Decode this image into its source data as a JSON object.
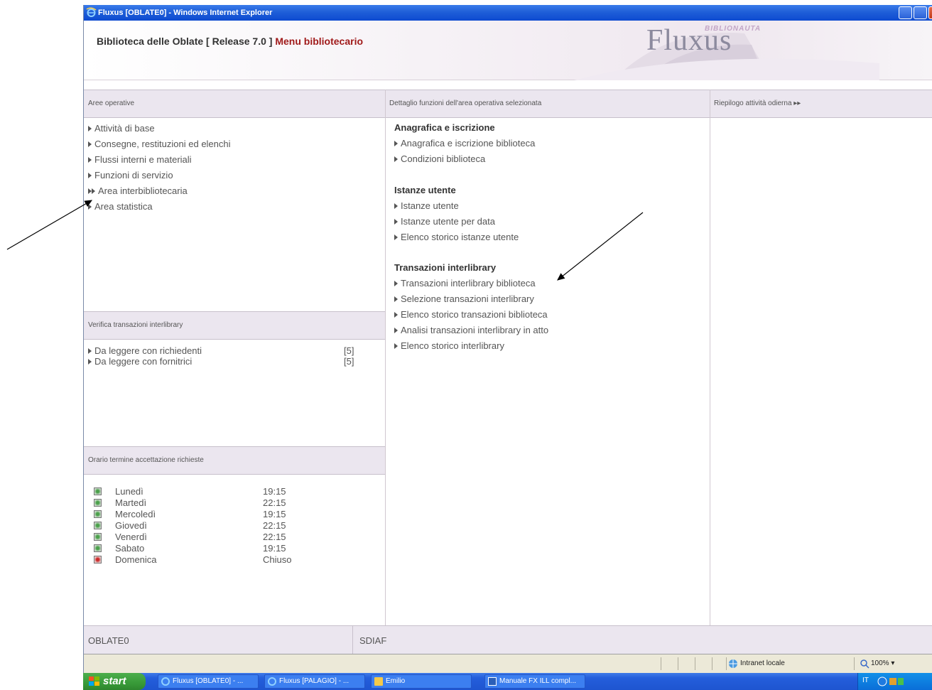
{
  "window": {
    "title": "Fluxus [OBLATE0] - Windows Internet Explorer"
  },
  "header": {
    "library": "Biblioteca delle Oblate [ Release 7.0 ]",
    "menu": "Menu bibliotecario",
    "brand": "Fluxus",
    "brand_small": "BIBLIONAUTA"
  },
  "left": {
    "heading": "Aree operative",
    "items": [
      {
        "label": "Attività di base",
        "marker": "single"
      },
      {
        "label": "Consegne, restituzioni ed elenchi",
        "marker": "single"
      },
      {
        "label": "Flussi interni e materiali",
        "marker": "single"
      },
      {
        "label": "Funzioni di servizio",
        "marker": "single"
      },
      {
        "label": "Area interbibliotecaria",
        "marker": "double"
      },
      {
        "label": "Area statistica",
        "marker": "single"
      }
    ]
  },
  "verify": {
    "heading": "Verifica transazioni interlibrary",
    "items": [
      {
        "label": "Da leggere con richiedenti",
        "count": "[5]"
      },
      {
        "label": "Da leggere con fornitrici",
        "count": "[5]"
      }
    ]
  },
  "hours": {
    "heading": "Orario termine accettazione richieste",
    "rows": [
      {
        "day": "Lunedì",
        "time": "19:15",
        "status": "green"
      },
      {
        "day": "Martedì",
        "time": "22:15",
        "status": "green"
      },
      {
        "day": "Mercoledì",
        "time": "19:15",
        "status": "green"
      },
      {
        "day": "Giovedì",
        "time": "22:15",
        "status": "green"
      },
      {
        "day": "Venerdì",
        "time": "22:15",
        "status": "green"
      },
      {
        "day": "Sabato",
        "time": "19:15",
        "status": "green"
      },
      {
        "day": "Domenica",
        "time": "Chiuso",
        "status": "red"
      }
    ]
  },
  "middle": {
    "heading": "Dettaglio funzioni dell'area operativa selezionata",
    "sections": [
      {
        "title": "Anagrafica e iscrizione",
        "items": [
          "Anagrafica e iscrizione biblioteca",
          "Condizioni biblioteca"
        ]
      },
      {
        "title": "Istanze utente",
        "items": [
          "Istanze utente",
          "Istanze utente per data",
          "Elenco storico istanze utente"
        ]
      },
      {
        "title": "Transazioni interlibrary",
        "items": [
          "Transazioni interlibrary biblioteca",
          "Selezione transazioni interlibrary",
          "Elenco storico transazioni biblioteca",
          "Analisi transazioni interlibrary in atto",
          "Elenco storico interlibrary"
        ]
      }
    ]
  },
  "right": {
    "heading": "Riepilogo attività odierna ▸▸"
  },
  "footer": {
    "left": "OBLATE0",
    "mid": "SDIAF"
  },
  "statusbar": {
    "zone": "Intranet locale",
    "zoom": "100%"
  },
  "taskbar": {
    "start": "start",
    "tasks": [
      "Fluxus [OBLATE0] - ...",
      "Fluxus [PALAGIO] - ...",
      "Emilio",
      "Manuale FX ILL compl..."
    ],
    "lang": "IT"
  },
  "colors": {
    "titlebar": "#1f5fd8",
    "panel_head": "#ebe6ef",
    "menu_accent": "#a01a1a",
    "start_green": "#389a38"
  }
}
